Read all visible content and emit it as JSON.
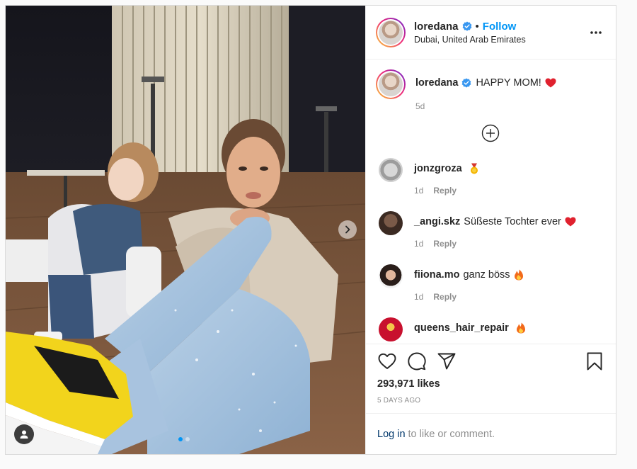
{
  "post": {
    "author": {
      "username": "loredana",
      "verified": true,
      "follow_label": "Follow",
      "location": "Dubai, United Arab Emirates"
    },
    "caption": {
      "username": "loredana",
      "text": "HAPPY MOM!",
      "emoji": "red-heart",
      "time": "5d"
    },
    "comments": [
      {
        "username": "jonzgroza",
        "text": "",
        "emoji": "medal",
        "time": "1d",
        "reply_label": "Reply"
      },
      {
        "username": "_angi.skz",
        "text": "Süßeste Tochter ever",
        "emoji": "red-heart",
        "time": "1d",
        "reply_label": "Reply"
      },
      {
        "username": "fiiona.mo",
        "text": "ganz böss",
        "emoji": "fire",
        "time": "1d",
        "reply_label": "Reply"
      },
      {
        "username": "queens_hair_repair",
        "text": "",
        "emoji": "fire",
        "time": "",
        "reply_label": ""
      }
    ],
    "likes": "293,971 likes",
    "date": "5 DAYS AGO",
    "login": {
      "link_label": "Log in",
      "rest": "to like or comment."
    },
    "carousel": {
      "total": 2,
      "active": 1
    }
  },
  "colors": {
    "accent": "#0095f6",
    "text": "#262626",
    "muted": "#8e8e8e",
    "border": "#dbdbdb",
    "heart": "#ed4956",
    "login_link": "#00376b"
  }
}
